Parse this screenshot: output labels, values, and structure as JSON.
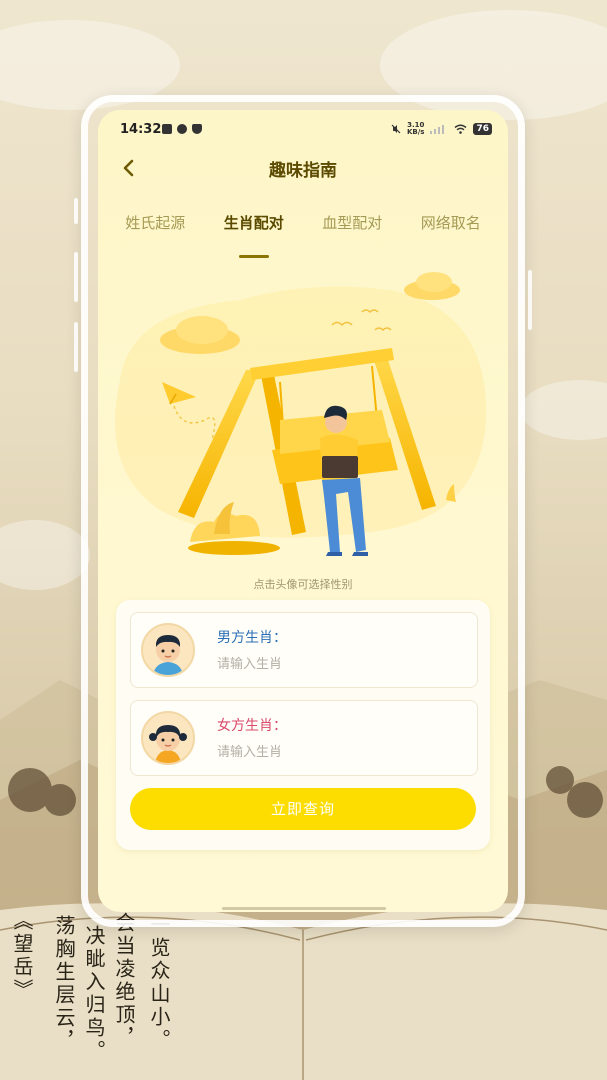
{
  "status_bar": {
    "time": "14:32",
    "net_speed_value": "3.10",
    "net_speed_unit": "KB/s",
    "battery": "76"
  },
  "header": {
    "title": "趣味指南",
    "back_icon": "chevron-left-icon"
  },
  "tabs": [
    {
      "label": "姓氏起源",
      "active": false
    },
    {
      "label": "生肖配对",
      "active": true
    },
    {
      "label": "血型配对",
      "active": false
    },
    {
      "label": "网络取名",
      "active": false
    }
  ],
  "hint": "点击头像可选择性别",
  "form": {
    "male": {
      "label": "男方生肖：",
      "placeholder": "请输入生肖",
      "value": ""
    },
    "female": {
      "label": "女方生肖：",
      "placeholder": "请输入生肖",
      "value": ""
    },
    "submit_label": "立即查询"
  },
  "background_text": {
    "col1": "荡胸生层云，",
    "col2": "决眦入归鸟。",
    "col3": "会当凌绝顶，",
    "col4": "一览众山小。",
    "col5": "《望岳》"
  },
  "colors": {
    "accent": "#fddd00",
    "title": "#5b4a00",
    "male_label": "#2c6fb6",
    "female_label": "#d94a6a"
  }
}
